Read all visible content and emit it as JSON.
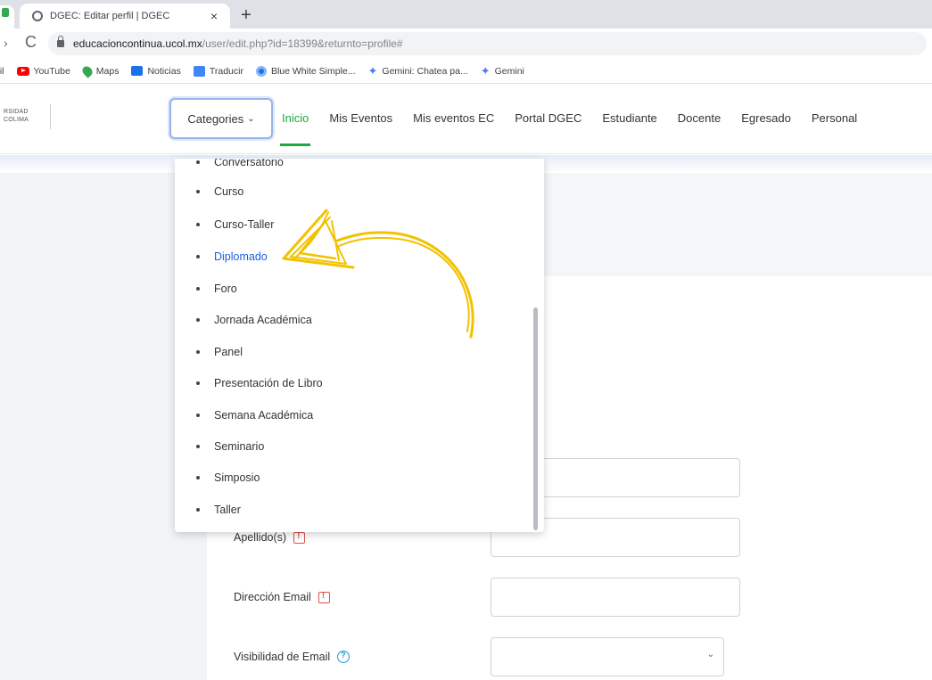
{
  "browser": {
    "tab": {
      "title": "DGEC: Editar perfil | DGEC",
      "close": "×"
    },
    "new_tab": "+",
    "nav": {
      "forward": "›",
      "reload": "C"
    },
    "url": {
      "domain": "educacioncontinua.ucol.mx",
      "path": "/user/edit.php?id=18399&returnto=profile#"
    },
    "bookmarks": [
      {
        "label": "ail",
        "icon": "none"
      },
      {
        "label": "YouTube",
        "icon": "youtube-icon"
      },
      {
        "label": "Maps",
        "icon": "maps-icon"
      },
      {
        "label": "Noticias",
        "icon": "news-icon"
      },
      {
        "label": "Traducir",
        "icon": "translate-icon"
      },
      {
        "label": "Blue White Simple...",
        "icon": "blue-white-icon"
      },
      {
        "label": "Gemini: Chatea pa...",
        "icon": "gemini-icon"
      },
      {
        "label": "Gemini",
        "icon": "gemini-icon"
      }
    ]
  },
  "header": {
    "logo_line1": "RSIDAD",
    "logo_line2": "COLIMA",
    "categories_label": "Categories",
    "categories_caret": "⌄",
    "nav": [
      "Inicio",
      "Mis Eventos",
      "Mis eventos EC",
      "Portal DGEC",
      "Estudiante",
      "Docente",
      "Egresado",
      "Personal"
    ],
    "active_nav": "Inicio"
  },
  "dropdown": {
    "items": [
      "Conversatorio",
      "Curso",
      "Curso-Taller",
      "Diplomado",
      "Foro",
      "Jornada Académica",
      "Panel",
      "Presentación de Libro",
      "Semana Académica",
      "Seminario",
      "Simposio",
      "Taller"
    ],
    "highlighted": "Diplomado"
  },
  "form": {
    "apellidos_label": "Apellido(s)",
    "email_label": "Dirección Email",
    "visibility_label": "Visibilidad de Email",
    "visibility_caret": "⌄"
  },
  "colors": {
    "active_nav": "#1fa83f",
    "highlight_link": "#1a5fe0",
    "annotation_arrow": "#f2c200",
    "required_icon": "#d9534f",
    "help_icon": "#1a9bd7"
  }
}
